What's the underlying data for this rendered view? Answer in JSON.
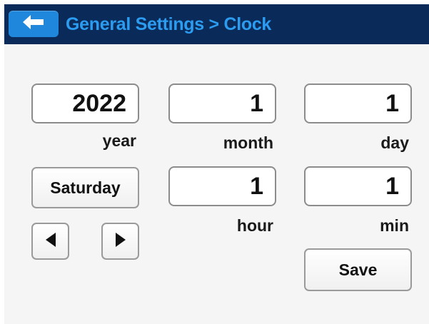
{
  "header": {
    "title": "General Settings > Clock",
    "back_icon": "arrow-left-icon",
    "accent_color": "#1f88dc",
    "bar_color": "#0a2a5a"
  },
  "clock": {
    "year": {
      "value": "2022",
      "label": "year"
    },
    "month": {
      "value": "1",
      "label": "month"
    },
    "day": {
      "value": "1",
      "label": "day"
    },
    "hour": {
      "value": "1",
      "label": "hour"
    },
    "min": {
      "value": "1",
      "label": "min"
    },
    "weekday": "Saturday",
    "prev_icon": "triangle-left-icon",
    "next_icon": "triangle-right-icon",
    "save_label": "Save"
  }
}
